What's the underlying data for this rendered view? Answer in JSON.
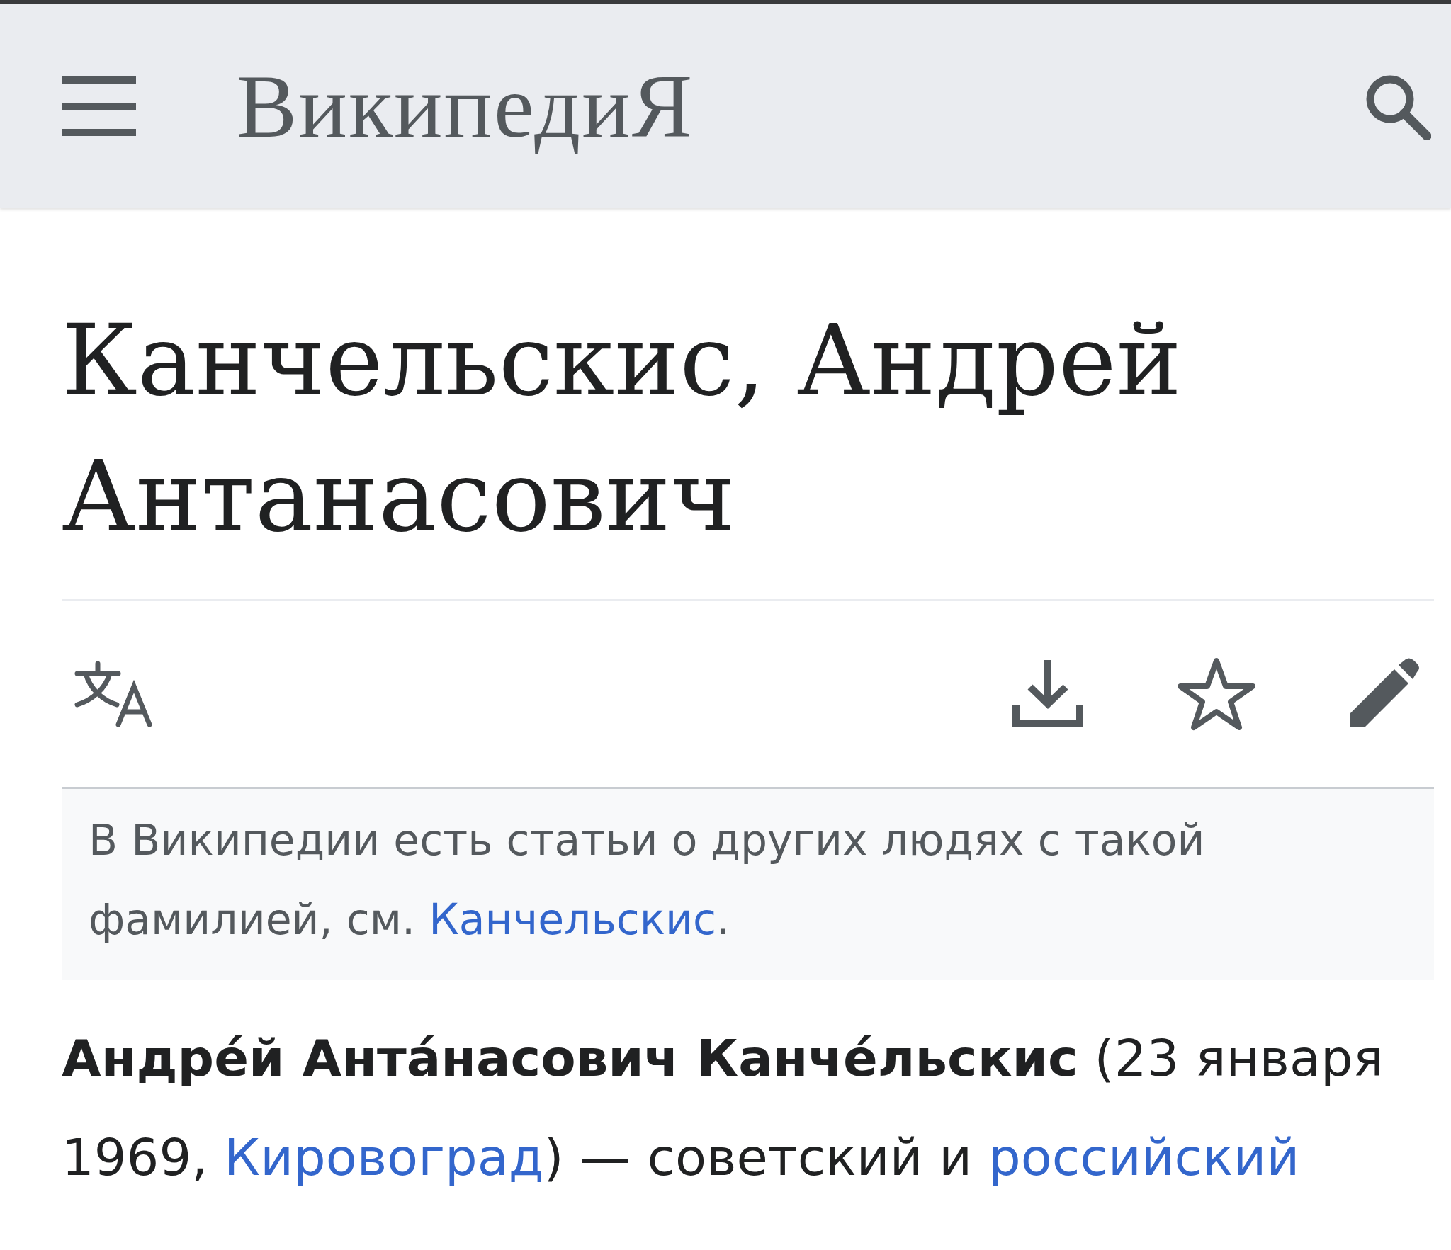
{
  "header": {
    "logo": "ВикипедиЯ"
  },
  "title": "Канчельскис, Андрей Антанасович",
  "hatnote": [
    {
      "kind": "text",
      "text": "В Википедии есть статьи о других людях с такой фамилией, см. "
    },
    {
      "kind": "link",
      "text": "Канчельскис"
    },
    {
      "kind": "text",
      "text": "."
    }
  ],
  "paragraph": [
    {
      "kind": "bold",
      "text": "Андре́й Анта́насович Канче́льскис"
    },
    {
      "kind": "text",
      "text": " (23 января"
    },
    {
      "kind": "break"
    },
    {
      "kind": "text",
      "text": "1969, "
    },
    {
      "kind": "link",
      "text": "Кировоград"
    },
    {
      "kind": "text",
      "text": ") — советский и "
    },
    {
      "kind": "link",
      "text": "российский"
    }
  ]
}
